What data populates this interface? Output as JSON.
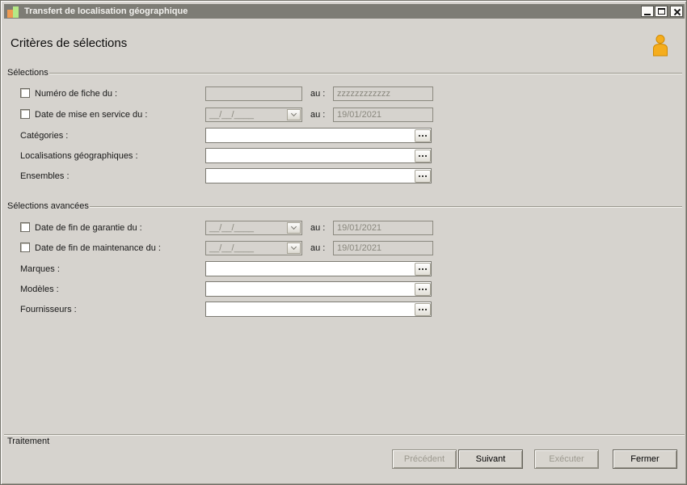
{
  "titlebar": {
    "title": "Transfert de localisation géographique"
  },
  "header": {
    "title": "Critères de sélections"
  },
  "selections": {
    "label": "Sélections",
    "numero_fiche": {
      "checked": false,
      "label": "Numéro de fiche du :",
      "from_value": "",
      "au_label": "au :",
      "to_value": "zzzzzzzzzzzz"
    },
    "date_mise_en_service": {
      "checked": false,
      "label": "Date de mise en service du :",
      "mask": "__/__/____",
      "au_label": "au :",
      "to_value": "19/01/2021"
    },
    "categories": {
      "label": "Catégories :",
      "value": ""
    },
    "localisations": {
      "label": "Localisations géographiques :",
      "value": ""
    },
    "ensembles": {
      "label": "Ensembles :",
      "value": ""
    }
  },
  "selections_avancees": {
    "label": "Sélections avancées",
    "date_fin_garantie": {
      "checked": false,
      "label": "Date de fin de garantie du :",
      "mask": "__/__/____",
      "au_label": "au :",
      "to_value": "19/01/2021"
    },
    "date_fin_maintenance": {
      "checked": false,
      "label": "Date de fin de maintenance du :",
      "mask": "__/__/____",
      "au_label": "au :",
      "to_value": "19/01/2021"
    },
    "marques": {
      "label": "Marques :",
      "value": ""
    },
    "modeles": {
      "label": "Modèles :",
      "value": ""
    },
    "fournisseurs": {
      "label": "Fournisseurs :",
      "value": ""
    }
  },
  "traitement": {
    "label": "Traitement"
  },
  "footer_buttons": {
    "precedent": {
      "label": "Précédent",
      "enabled": false
    },
    "suivant": {
      "label": "Suivant",
      "enabled": true
    },
    "executer": {
      "label": "Exécuter",
      "enabled": false
    },
    "fermer": {
      "label": "Fermer",
      "enabled": true
    }
  },
  "colors": {
    "titlebar_bg": "#7d7c75",
    "window_bg": "#d6d3ce",
    "disabled_text": "#8a887e",
    "user_icon": "#f5ad1d",
    "logo_orange": "#ef9b52",
    "logo_green": "#b5e886"
  }
}
